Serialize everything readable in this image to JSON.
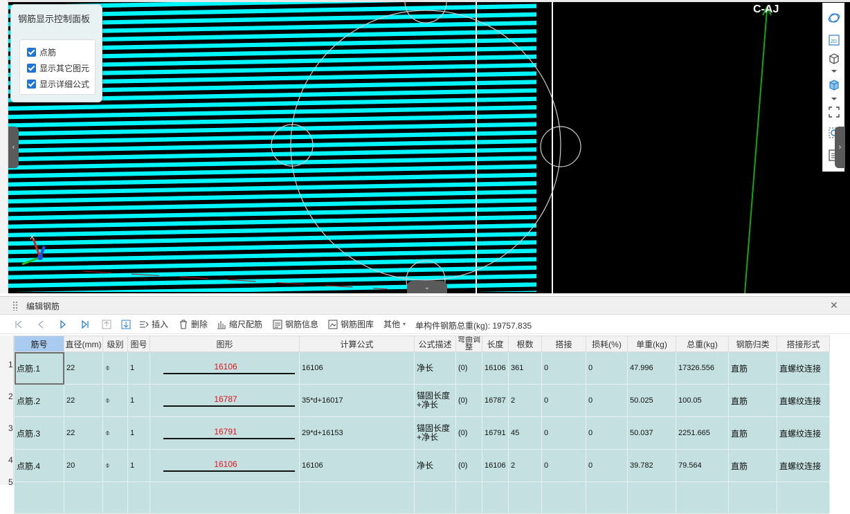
{
  "viewport": {
    "axis_label": "C-AJ",
    "stripe_color": "#00f5ff"
  },
  "control_panel": {
    "title": "钢筋显示控制面板",
    "options": [
      {
        "label": "点筋",
        "checked": true
      },
      {
        "label": "显示其它图元",
        "checked": true
      },
      {
        "label": "显示详细公式",
        "checked": true
      }
    ]
  },
  "edit_panel": {
    "title": "编辑钢筋",
    "toolbar": {
      "insert": "插入",
      "delete": "删除",
      "scale_rebar": "缩尺配筋",
      "rebar_info": "钢筋信息",
      "rebar_library": "钢筋图库",
      "other": "其他",
      "total_weight_label": "单构件钢筋总重(kg): 19757.835"
    },
    "columns": [
      "筋号",
      "直径(mm)",
      "级别",
      "图号",
      "图形",
      "计算公式",
      "公式描述",
      "弯曲调整",
      "长度",
      "根数",
      "搭接",
      "损耗(%)",
      "单重(kg)",
      "总重(kg)",
      "钢筋归类",
      "搭接形式"
    ],
    "grade_symbol": "⌽",
    "rows": [
      {
        "row": "1",
        "name": "点筋.1",
        "diameter": "22",
        "figure_no": "1",
        "shape_value": "16106",
        "formula": "16106",
        "desc": "净长",
        "bend": "(0)",
        "length": "16106",
        "count": "361",
        "lap": "0",
        "loss": "0",
        "unit_weight": "47.996",
        "total_weight": "17326.556",
        "category": "直筋",
        "lap_type": "直螺纹连接"
      },
      {
        "row": "2",
        "name": "点筋.2",
        "diameter": "22",
        "figure_no": "1",
        "shape_value": "16787",
        "formula": "35*d+16017",
        "desc": "锚固长度+净长",
        "bend": "(0)",
        "length": "16787",
        "count": "2",
        "lap": "0",
        "loss": "0",
        "unit_weight": "50.025",
        "total_weight": "100.05",
        "category": "直筋",
        "lap_type": "直螺纹连接"
      },
      {
        "row": "3",
        "name": "点筋.3",
        "diameter": "22",
        "figure_no": "1",
        "shape_value": "16791",
        "formula": "29*d+16153",
        "desc": "锚固长度+净长",
        "bend": "(0)",
        "length": "16791",
        "count": "45",
        "lap": "0",
        "loss": "0",
        "unit_weight": "50.037",
        "total_weight": "2251.665",
        "category": "直筋",
        "lap_type": "直螺纹连接"
      },
      {
        "row": "4",
        "name": "点筋.4",
        "diameter": "20",
        "figure_no": "1",
        "shape_value": "16106",
        "formula": "16106",
        "desc": "净长",
        "bend": "(0)",
        "length": "16106",
        "count": "2",
        "lap": "0",
        "loss": "0",
        "unit_weight": "39.782",
        "total_weight": "79.564",
        "category": "直筋",
        "lap_type": "直螺纹连接"
      }
    ],
    "next_row_number": "5"
  }
}
